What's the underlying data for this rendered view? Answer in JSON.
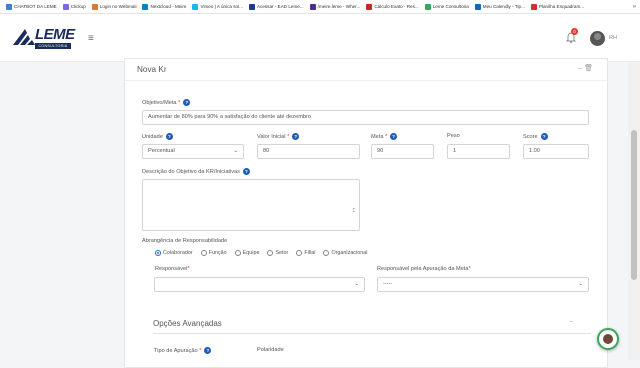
{
  "bookmarks": [
    {
      "label": "CHATBOT DA LEME",
      "color": "#3b7dd8"
    },
    {
      "label": "Clickup",
      "color": "#7b68ee"
    },
    {
      "label": "Login no Webmail",
      "color": "#e07a2b"
    },
    {
      "label": "Nextcloud - Meire",
      "color": "#0082c9"
    },
    {
      "label": "Vimeo | A única sol...",
      "color": "#1ab7ea"
    },
    {
      "label": "Acessar - EAD Leme...",
      "color": "#1a3c8c"
    },
    {
      "label": "/meire.leme - Wher...",
      "color": "#4a2f8c"
    },
    {
      "label": "Cálculo Exato - Res...",
      "color": "#c62828"
    },
    {
      "label": "Leme Consultoria",
      "color": "#3aa55c"
    },
    {
      "label": "Meu Calendly - Tip...",
      "color": "#1565c0"
    },
    {
      "label": "Planilha Enquadram...",
      "color": "#d32f2f"
    }
  ],
  "bookmarks_more": "»",
  "header": {
    "logo_text": "LEME",
    "logo_sub": "CONSULTORIA",
    "menu_glyph": "≡",
    "notification_count": "0",
    "user_initials": "RH"
  },
  "panel": {
    "title": "Nova Kr",
    "actions": "– 🗑"
  },
  "form": {
    "objetivo_label": "Objetivo/Meta",
    "objetivo_value": "Aumentar de 80% para 90% a satisfação do cliente até dezembro",
    "unidade_label": "Unidade",
    "unidade_value": "Percentual",
    "valor_inicial_label": "Valor Inicial",
    "valor_inicial_value": "80",
    "meta_label": "Meta",
    "meta_value": "90",
    "peso_label": "Peso",
    "peso_value": "1",
    "score_label": "Score",
    "score_value": "1.00",
    "descricao_label": "Descrição do Objetivo da KR/Iniciativas",
    "abrangencia_label": "Abrangência de Responsabilidade",
    "abrangencia_options": [
      "Colaborador",
      "Função",
      "Equipe",
      "Setor",
      "Filial",
      "Organizacional"
    ],
    "abrangencia_selected": "Colaborador",
    "responsavel_label": "Responsável",
    "responsavel_value": "",
    "responsavel_apuracao_label": "Responsável pela Apuração da Meta",
    "responsavel_apuracao_value": "-----",
    "opcoes_title": "Opções Avançadas",
    "opcoes_toggle": "–",
    "tipo_apuracao_label": "Tipo de Apuração",
    "polaridade_label": "Polaridade"
  },
  "colors": {
    "accent": "#1e5bb8",
    "required": "#e53935",
    "brand": "#1a2c5b"
  }
}
